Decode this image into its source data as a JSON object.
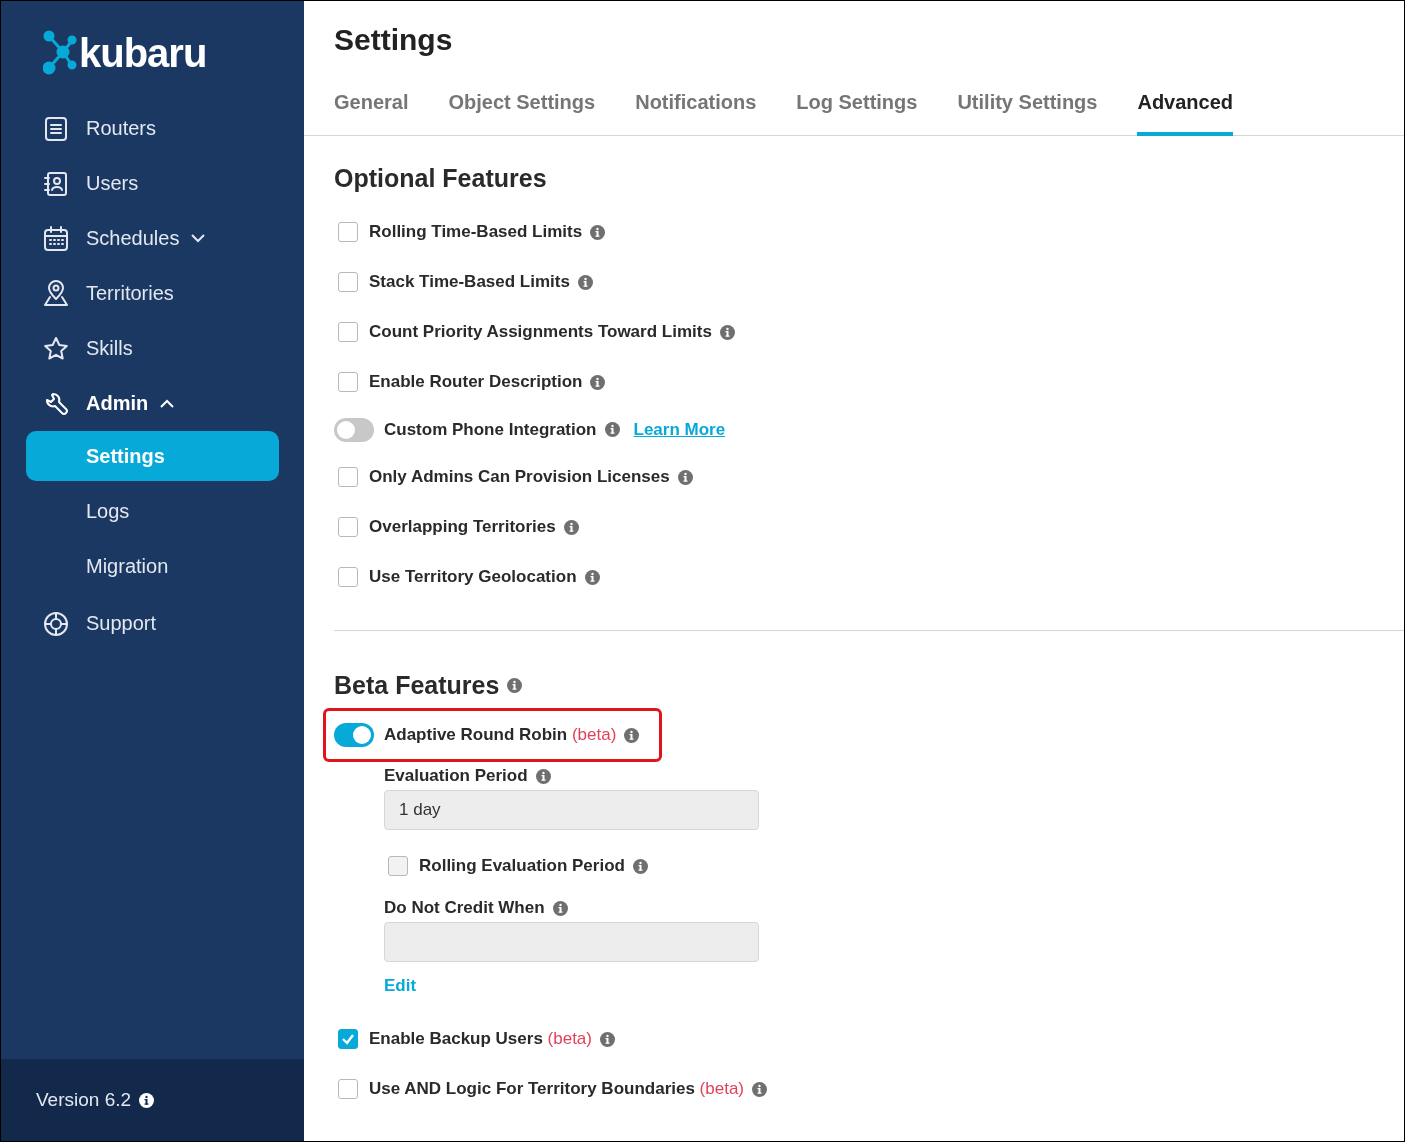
{
  "sidebar": {
    "logo": "kubaru",
    "items": [
      {
        "label": "Routers"
      },
      {
        "label": "Users"
      },
      {
        "label": "Schedules",
        "expanded": false
      },
      {
        "label": "Territories"
      },
      {
        "label": "Skills"
      },
      {
        "label": "Admin",
        "expanded": true,
        "children": [
          {
            "label": "Settings",
            "selected": true
          },
          {
            "label": "Logs",
            "selected": false
          },
          {
            "label": "Migration",
            "selected": false
          }
        ]
      },
      {
        "label": "Support"
      }
    ],
    "version": "Version 6.2"
  },
  "page": {
    "title": "Settings",
    "tabs": [
      {
        "label": "General",
        "selected": false
      },
      {
        "label": "Object Settings",
        "selected": false
      },
      {
        "label": "Notifications",
        "selected": false
      },
      {
        "label": "Log Settings",
        "selected": false
      },
      {
        "label": "Utility Settings",
        "selected": false
      },
      {
        "label": "Advanced",
        "selected": true
      }
    ],
    "optional_features": {
      "title": "Optional Features",
      "items": [
        {
          "kind": "checkbox",
          "label": "Rolling Time-Based Limits",
          "checked": false
        },
        {
          "kind": "checkbox",
          "label": "Stack Time-Based Limits",
          "checked": false
        },
        {
          "kind": "checkbox",
          "label": "Count Priority Assignments Toward Limits",
          "checked": false
        },
        {
          "kind": "checkbox",
          "label": "Enable Router Description",
          "checked": false
        },
        {
          "kind": "toggle",
          "label": "Custom Phone Integration",
          "checked": false,
          "link": "Learn More"
        },
        {
          "kind": "checkbox",
          "label": "Only Admins Can Provision Licenses",
          "checked": false
        },
        {
          "kind": "checkbox",
          "label": "Overlapping Territories",
          "checked": false
        },
        {
          "kind": "checkbox",
          "label": "Use Territory Geolocation",
          "checked": false
        }
      ]
    },
    "beta_features": {
      "title": "Beta Features",
      "items": [
        {
          "kind": "toggle",
          "label": "Adaptive Round Robin",
          "beta": "(beta)",
          "checked": true,
          "highlighted": true,
          "settings": [
            {
              "kind": "field",
              "label": "Evaluation Period",
              "value": "1 day"
            },
            {
              "kind": "checkbox",
              "label": "Rolling Evaluation Period",
              "checked": false
            },
            {
              "kind": "field",
              "label": "Do Not Credit When"
            },
            {
              "kind": "link",
              "label": "Edit"
            }
          ]
        },
        {
          "kind": "checkbox",
          "label": "Enable Backup Users",
          "beta": "(beta)",
          "checked": true,
          "highlighted": false
        },
        {
          "kind": "checkbox",
          "label": "Use AND Logic For Territory Boundaries",
          "beta": "(beta)",
          "checked": false,
          "highlighted": false
        }
      ]
    }
  }
}
